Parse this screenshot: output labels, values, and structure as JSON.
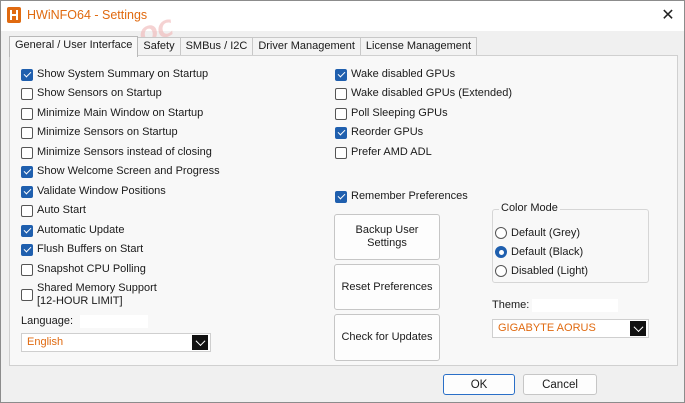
{
  "window": {
    "title": "HWiNFO64 - Settings",
    "close_glyph": "✕"
  },
  "watermark": "Windows OC",
  "tabs": [
    {
      "label": "General / User Interface",
      "active": true
    },
    {
      "label": "Safety",
      "active": false
    },
    {
      "label": "SMBus / I2C",
      "active": false
    },
    {
      "label": "Driver Management",
      "active": false
    },
    {
      "label": "License Management",
      "active": false
    }
  ],
  "left_options": [
    {
      "label": "Show System Summary on Startup",
      "checked": true
    },
    {
      "label": "Show Sensors on Startup",
      "checked": false
    },
    {
      "label": "Minimize Main Window on Startup",
      "checked": false
    },
    {
      "label": "Minimize Sensors on Startup",
      "checked": false
    },
    {
      "label": "Minimize Sensors instead of closing",
      "checked": false
    },
    {
      "label": "Show Welcome Screen and Progress",
      "checked": true
    },
    {
      "label": "Validate Window Positions",
      "checked": true
    },
    {
      "label": "Auto Start",
      "checked": false
    },
    {
      "label": "Automatic Update",
      "checked": true
    },
    {
      "label": "Flush Buffers on Start",
      "checked": true
    },
    {
      "label": "Snapshot CPU Polling",
      "checked": false
    },
    {
      "label": "Shared Memory Support",
      "label2": "[12-HOUR LIMIT]",
      "checked": false
    }
  ],
  "right_options": [
    {
      "label": "Wake disabled GPUs",
      "checked": true
    },
    {
      "label": "Wake disabled GPUs (Extended)",
      "checked": false
    },
    {
      "label": "Poll Sleeping GPUs",
      "checked": false
    },
    {
      "label": "Reorder GPUs",
      "checked": true
    },
    {
      "label": "Prefer AMD ADL",
      "checked": false
    }
  ],
  "remember": {
    "label": "Remember Preferences",
    "checked": true
  },
  "language": {
    "label": "Language:",
    "value": "English"
  },
  "buttons": {
    "backup": {
      "line1": "Backup User",
      "line2": "Settings"
    },
    "reset": "Reset Preferences",
    "updates": "Check for Updates"
  },
  "color_mode": {
    "title": "Color Mode",
    "options": [
      {
        "label": "Default (Grey)",
        "checked": false
      },
      {
        "label": "Default (Black)",
        "checked": true
      },
      {
        "label": "Disabled (Light)",
        "checked": false
      }
    ]
  },
  "theme": {
    "label": "Theme:",
    "value": "GIGABYTE AORUS"
  },
  "footer": {
    "ok": "OK",
    "cancel": "Cancel"
  },
  "colors": {
    "accent": "#e06a10",
    "check": "#1f5fae"
  }
}
